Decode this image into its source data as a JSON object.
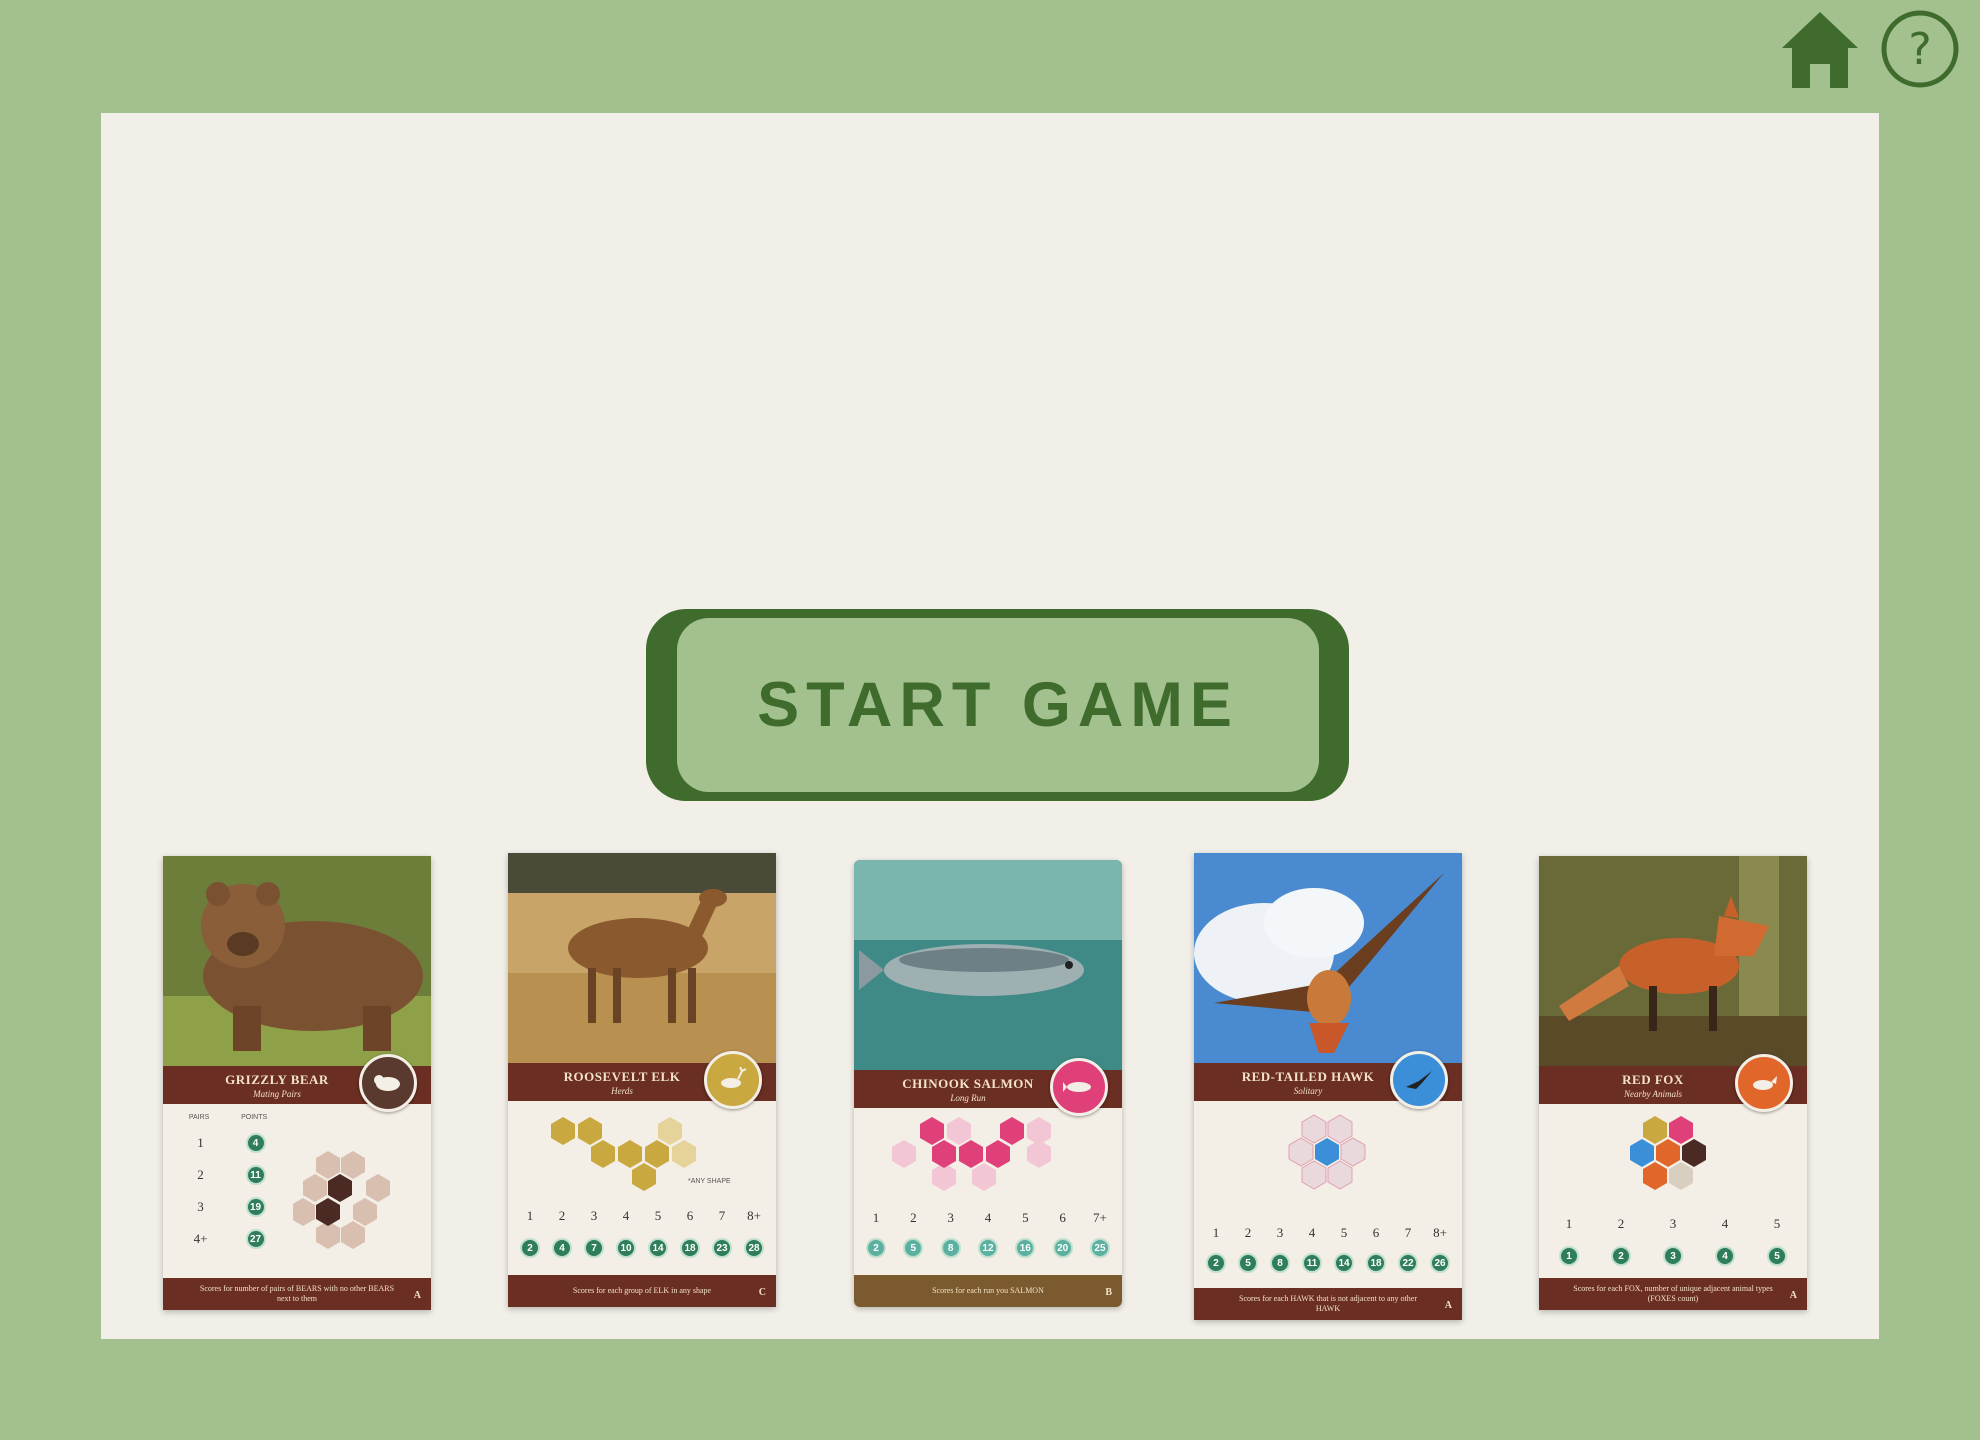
{
  "header": {
    "home_icon": "home-icon",
    "help_icon": "help-circle-icon",
    "help_glyph": "?"
  },
  "colors": {
    "background": "#a3c18f",
    "panel": "#f2efe8",
    "accent": "#3f6b2d",
    "card_banner": "#6a2e22"
  },
  "start_button": {
    "label": "START GAME"
  },
  "cards": [
    {
      "name": "GRIZZLY BEAR",
      "subtitle": "Mating Pairs",
      "emblem": "bear-icon",
      "emblem_color": "#5a3a2e",
      "rule_text": "Scores for number of pairs of BEARS with no other BEARS next to them",
      "letter": "A",
      "table_headers": [
        "PAIRS",
        "POINTS"
      ],
      "table_rows": [
        {
          "count": "1",
          "points": "4"
        },
        {
          "count": "2",
          "points": "11"
        },
        {
          "count": "3",
          "points": "19"
        },
        {
          "count": "4+",
          "points": "27"
        }
      ]
    },
    {
      "name": "ROOSEVELT ELK",
      "subtitle": "Herds",
      "emblem": "elk-icon",
      "emblem_color": "#c9a840",
      "rule_text": "Scores for each group of ELK in any shape",
      "letter": "C",
      "shape_note": "*ANY SHAPE",
      "counts": [
        "1",
        "2",
        "3",
        "4",
        "5",
        "6",
        "7",
        "8+"
      ],
      "points": [
        "2",
        "4",
        "7",
        "10",
        "14",
        "18",
        "23",
        "28"
      ]
    },
    {
      "name": "CHINOOK SALMON",
      "subtitle": "Long Run",
      "emblem": "salmon-icon",
      "emblem_color": "#e0407a",
      "rule_text": "Scores for each run you SALMON",
      "letter": "B",
      "counts": [
        "1",
        "2",
        "3",
        "4",
        "5",
        "6",
        "7+"
      ],
      "points": [
        "2",
        "5",
        "8",
        "12",
        "16",
        "20",
        "25"
      ]
    },
    {
      "name": "RED-TAILED HAWK",
      "subtitle": "Solitary",
      "emblem": "hawk-icon",
      "emblem_color": "#3a8fd8",
      "rule_text": "Scores for each HAWK that is not adjacent to any other HAWK",
      "letter": "A",
      "counts": [
        "1",
        "2",
        "3",
        "4",
        "5",
        "6",
        "7",
        "8+"
      ],
      "points": [
        "2",
        "5",
        "8",
        "11",
        "14",
        "18",
        "22",
        "26"
      ]
    },
    {
      "name": "RED FOX",
      "subtitle": "Nearby Animals",
      "emblem": "fox-icon",
      "emblem_color": "#e0662a",
      "rule_text": "Scores for each FOX, number of unique adjacent animal types (FOXES count)",
      "letter": "A",
      "counts": [
        "1",
        "2",
        "3",
        "4",
        "5"
      ],
      "points": [
        "1",
        "2",
        "3",
        "4",
        "5"
      ]
    }
  ]
}
